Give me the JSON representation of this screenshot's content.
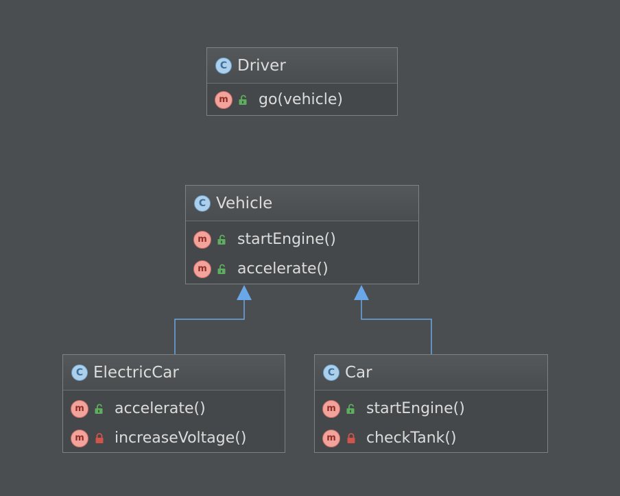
{
  "diagram": {
    "classes": [
      {
        "name": "Driver",
        "icon": "class-icon",
        "methods": [
          {
            "label": "go(vehicle)",
            "visibility": "public",
            "icon": "method-icon"
          }
        ]
      },
      {
        "name": "Vehicle",
        "icon": "class-icon",
        "methods": [
          {
            "label": "startEngine()",
            "visibility": "public",
            "icon": "method-icon"
          },
          {
            "label": "accelerate()",
            "visibility": "public",
            "icon": "method-icon"
          }
        ]
      },
      {
        "name": "ElectricCar",
        "icon": "class-icon",
        "methods": [
          {
            "label": "accelerate()",
            "visibility": "public",
            "icon": "method-icon"
          },
          {
            "label": "increaseVoltage()",
            "visibility": "private",
            "icon": "method-icon"
          }
        ]
      },
      {
        "name": "Car",
        "icon": "class-icon",
        "methods": [
          {
            "label": "startEngine()",
            "visibility": "public",
            "icon": "method-icon"
          },
          {
            "label": "checkTank()",
            "visibility": "private",
            "icon": "method-icon"
          }
        ]
      }
    ],
    "relations": [
      {
        "type": "inheritance",
        "from": "ElectricCar",
        "to": "Vehicle"
      },
      {
        "type": "inheritance",
        "from": "Car",
        "to": "Vehicle"
      }
    ],
    "badges": {
      "class_letter": "C",
      "method_letter": "m"
    },
    "colors": {
      "background": "#4b4e50",
      "edge": "#6aa7e8",
      "public_lock": "#5fae5f",
      "private_lock": "#d0554a"
    }
  }
}
